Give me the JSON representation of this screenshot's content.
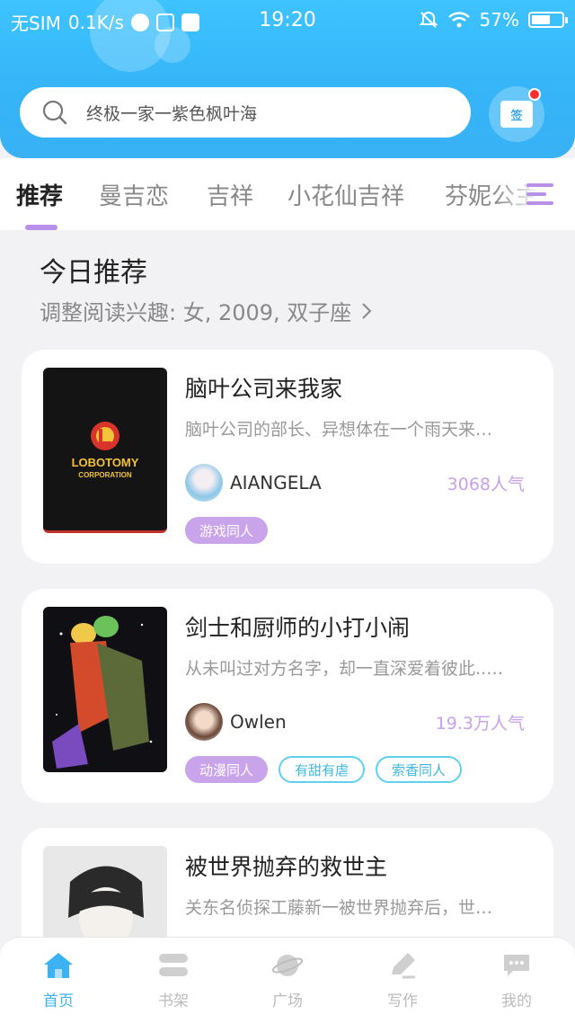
{
  "status_bar": {
    "carrier": "无SIM",
    "speed": "0.1K/s",
    "time": "19:20",
    "battery": "57%"
  },
  "search": {
    "placeholder": "终极一家一紫色枫叶海"
  },
  "signin": {
    "label": "签"
  },
  "tabs": [
    {
      "label": "推荐",
      "active": true
    },
    {
      "label": "曼吉恋"
    },
    {
      "label": "吉祥"
    },
    {
      "label": "小花仙吉祥"
    },
    {
      "label": "芬妮公主"
    }
  ],
  "section": {
    "title": "今日推荐",
    "subtitle": "调整阅读兴趣: 女, 2009, 双子座"
  },
  "cards": [
    {
      "cover_text": [
        "LOBOTOMY",
        "CORPORATION"
      ],
      "title": "脑叶公司来我家",
      "desc": "脑叶公司的部长、异想体在一个雨天来…",
      "author": "AIANGELA",
      "popularity": "3068人气",
      "tags": [
        "游戏同人"
      ]
    },
    {
      "title": "剑士和厨师的小打小闹",
      "desc": "从未叫过对方名字，却一直深爱着彼此..…",
      "author": "Owlen",
      "popularity": "19.3万人气",
      "tags": [
        "动漫同人",
        "有甜有虐",
        "索香同人"
      ]
    },
    {
      "title": "被世界抛弃的救世主",
      "desc": "关东名侦探工藤新一被世界抛弃后，世…"
    }
  ],
  "bottom_nav": [
    {
      "label": "首页",
      "icon": "home-icon",
      "active": true
    },
    {
      "label": "书架",
      "icon": "bookshelf-icon"
    },
    {
      "label": "广场",
      "icon": "planet-icon"
    },
    {
      "label": "写作",
      "icon": "pen-icon"
    },
    {
      "label": "我的",
      "icon": "chat-bubble-icon"
    }
  ],
  "colors": {
    "header_blue": "#3ec3ff",
    "accent_purple": "#c9a4ea",
    "accent_cyan": "#5fd0ee",
    "nav_active": "#3bb3f3"
  }
}
